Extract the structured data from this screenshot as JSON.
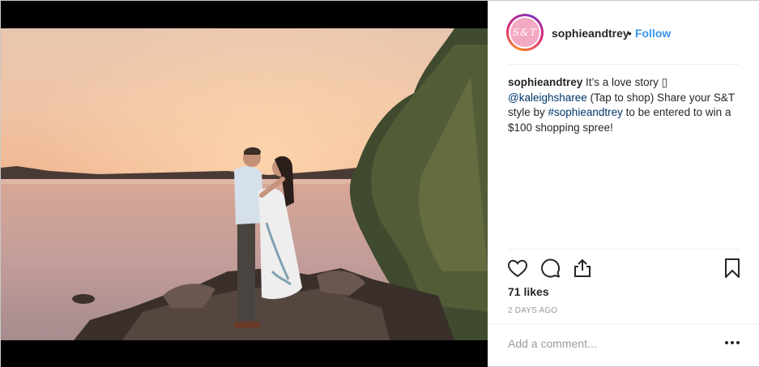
{
  "post": {
    "username": "sophieandtrey",
    "avatar_text": "S&T",
    "separator": "•",
    "follow_label": "Follow",
    "caption": {
      "username": "sophieandtrey",
      "text_1": " It’s a love story ",
      "emoji": "▯",
      "mention": "@kaleighsharee",
      "text_2": " (Tap to shop) Share your S&T style by ",
      "hashtag": "#sophieandtrey",
      "text_3": " to be entered to win a $100 shopping spree!"
    },
    "likes": "71 likes",
    "timestamp": "2 DAYS AGO",
    "comment_placeholder": "Add a comment..."
  },
  "icons": [
    "heart-icon",
    "comment-icon",
    "share-icon",
    "bookmark-icon",
    "more-options-icon"
  ],
  "colors": {
    "accent": "#3897f0",
    "link": "#003569",
    "text": "#262626",
    "muted": "#999999"
  }
}
